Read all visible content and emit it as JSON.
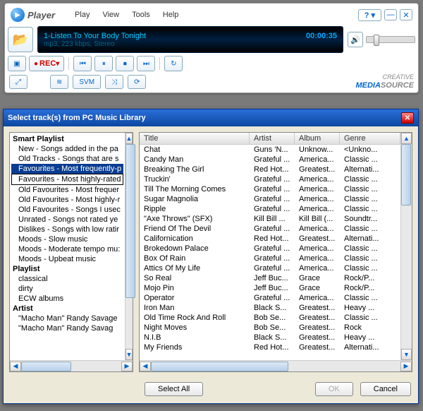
{
  "player": {
    "title": "Player",
    "menu": [
      "Play",
      "View",
      "Tools",
      "Help"
    ],
    "help_label": "?",
    "display": {
      "title": "1-Listen To Your Body Tonight",
      "time": "00:00:35",
      "info": "mp3, 223 kbps, Stereo"
    },
    "rec_label": "REC",
    "svm_label": "SVM",
    "brand_top": "CREATIVE",
    "brand_main": "MEDIA",
    "brand_suffix": "SOURCE"
  },
  "dialog": {
    "title": "Select track(s) from PC Music Library",
    "select_all": "Select All",
    "ok": "OK",
    "cancel": "Cancel",
    "sections": {
      "smart_playlist": "Smart Playlist",
      "playlist": "Playlist",
      "artist": "Artist"
    },
    "smart_items": [
      "New - Songs added in the pa",
      "Old Tracks - Songs that are s",
      "Favourites - Most frequently-p",
      "Favourites - Most highly-rated",
      "Old Favourites - Most frequer",
      "Old Favourites - Most highly-r",
      "Old Favourites - Songs I usec",
      "Unrated - Songs not rated ye",
      "Dislikes - Songs with low ratir",
      "Moods - Slow music",
      "Moods - Moderate tempo mu:",
      "Moods - Upbeat music"
    ],
    "playlist_items": [
      "classical",
      "dirty",
      "ECW albums"
    ],
    "artist_items": [
      "\"Macho Man\" Randy Savage",
      "\"Macho Man\" Randy Savag"
    ],
    "columns": {
      "title": "Title",
      "artist": "Artist",
      "album": "Album",
      "genre": "Genre"
    },
    "tracks": [
      {
        "title": "Chat",
        "artist": "Guns 'N...",
        "album": "Unknow...",
        "genre": "<Unkno..."
      },
      {
        "title": "Candy Man",
        "artist": "Grateful ...",
        "album": "America...",
        "genre": "Classic ..."
      },
      {
        "title": "Breaking The Girl",
        "artist": "Red Hot...",
        "album": "Greatest...",
        "genre": "Alternati..."
      },
      {
        "title": "Truckin'",
        "artist": "Grateful ...",
        "album": "America...",
        "genre": "Classic ..."
      },
      {
        "title": "Till The Morning Comes",
        "artist": "Grateful ...",
        "album": "America...",
        "genre": "Classic ..."
      },
      {
        "title": "Sugar Magnolia",
        "artist": "Grateful ...",
        "album": "America...",
        "genre": "Classic ..."
      },
      {
        "title": "Ripple",
        "artist": "Grateful ...",
        "album": "America...",
        "genre": "Classic ..."
      },
      {
        "title": "\"Axe Throws\" (SFX)",
        "artist": "Kill Bill ...",
        "album": "Kill Bill (...",
        "genre": "Soundtr..."
      },
      {
        "title": "Friend Of The Devil",
        "artist": "Grateful ...",
        "album": "America...",
        "genre": "Classic ..."
      },
      {
        "title": "Californication",
        "artist": "Red Hot...",
        "album": "Greatest...",
        "genre": "Alternati..."
      },
      {
        "title": "Brokedown Palace",
        "artist": "Grateful ...",
        "album": "America...",
        "genre": "Classic ..."
      },
      {
        "title": "Box Of Rain",
        "artist": "Grateful ...",
        "album": "America...",
        "genre": "Classic ..."
      },
      {
        "title": "Attics Of My Life",
        "artist": "Grateful ...",
        "album": "America...",
        "genre": "Classic ..."
      },
      {
        "title": "So Real",
        "artist": "Jeff Buc...",
        "album": "Grace",
        "genre": "Rock/P..."
      },
      {
        "title": "Mojo Pin",
        "artist": "Jeff Buc...",
        "album": "Grace",
        "genre": "Rock/P..."
      },
      {
        "title": "Operator",
        "artist": "Grateful ...",
        "album": "America...",
        "genre": "Classic ..."
      },
      {
        "title": "Iron Man",
        "artist": "Black S...",
        "album": "Greatest...",
        "genre": "Heavy ..."
      },
      {
        "title": "Old Time Rock And Roll",
        "artist": "Bob Se...",
        "album": "Greatest...",
        "genre": "Classic ..."
      },
      {
        "title": "Night Moves",
        "artist": "Bob Se...",
        "album": "Greatest...",
        "genre": "Rock"
      },
      {
        "title": "N.I.B",
        "artist": "Black S...",
        "album": "Greatest...",
        "genre": "Heavy ..."
      },
      {
        "title": "My Friends",
        "artist": "Red Hot...",
        "album": "Greatest...",
        "genre": "Alternati..."
      }
    ]
  }
}
